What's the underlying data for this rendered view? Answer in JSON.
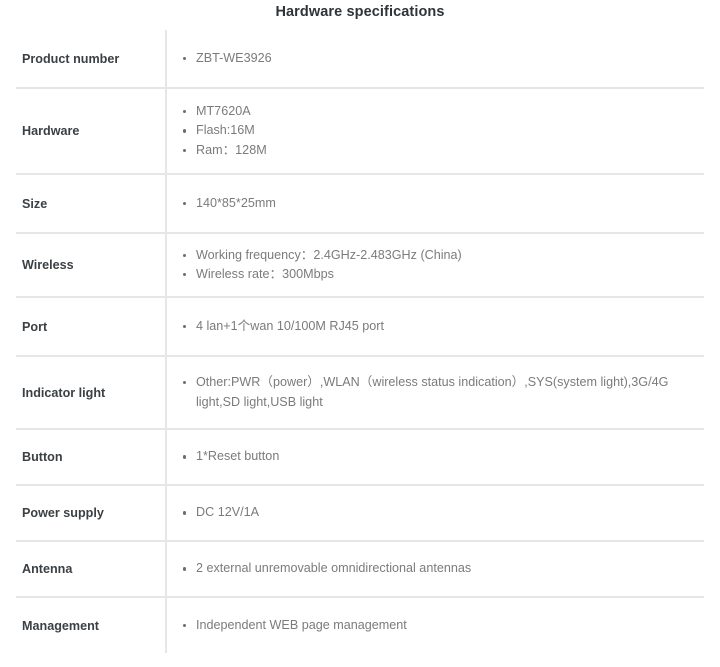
{
  "page": {
    "title": "Hardware specifications"
  },
  "colors": {
    "title_text": "#2f3438",
    "label_text": "#3b4044",
    "value_text": "#7b7b7b",
    "divider": "#e6e6e6",
    "background": "#ffffff",
    "bullet": "#6e6e6e"
  },
  "spec_table": {
    "rows": [
      {
        "label": "Product number",
        "values": [
          "ZBT-WE3926"
        ]
      },
      {
        "label": "Hardware",
        "values": [
          "MT7620A",
          "Flash:16M",
          "Ram：128M"
        ]
      },
      {
        "label": "Size",
        "values": [
          "140*85*25mm"
        ]
      },
      {
        "label": "Wireless",
        "values": [
          "Working frequency：2.4GHz-2.483GHz (China)",
          "Wireless rate：300Mbps"
        ]
      },
      {
        "label": "Port",
        "values": [
          "4 lan+1个wan 10/100M RJ45 port"
        ]
      },
      {
        "label": "Indicator light",
        "values": [
          "Other:PWR（power）,WLAN（wireless status indication）,SYS(system light),3G/4G light,SD light,USB light"
        ]
      },
      {
        "label": "Button",
        "values": [
          "1*Reset button"
        ]
      },
      {
        "label": "Power supply",
        "values": [
          "DC 12V/1A"
        ]
      },
      {
        "label": "Antenna",
        "values": [
          "2 external unremovable omnidirectional antennas"
        ]
      },
      {
        "label": "Management",
        "values": [
          "Independent WEB page management"
        ]
      }
    ]
  }
}
